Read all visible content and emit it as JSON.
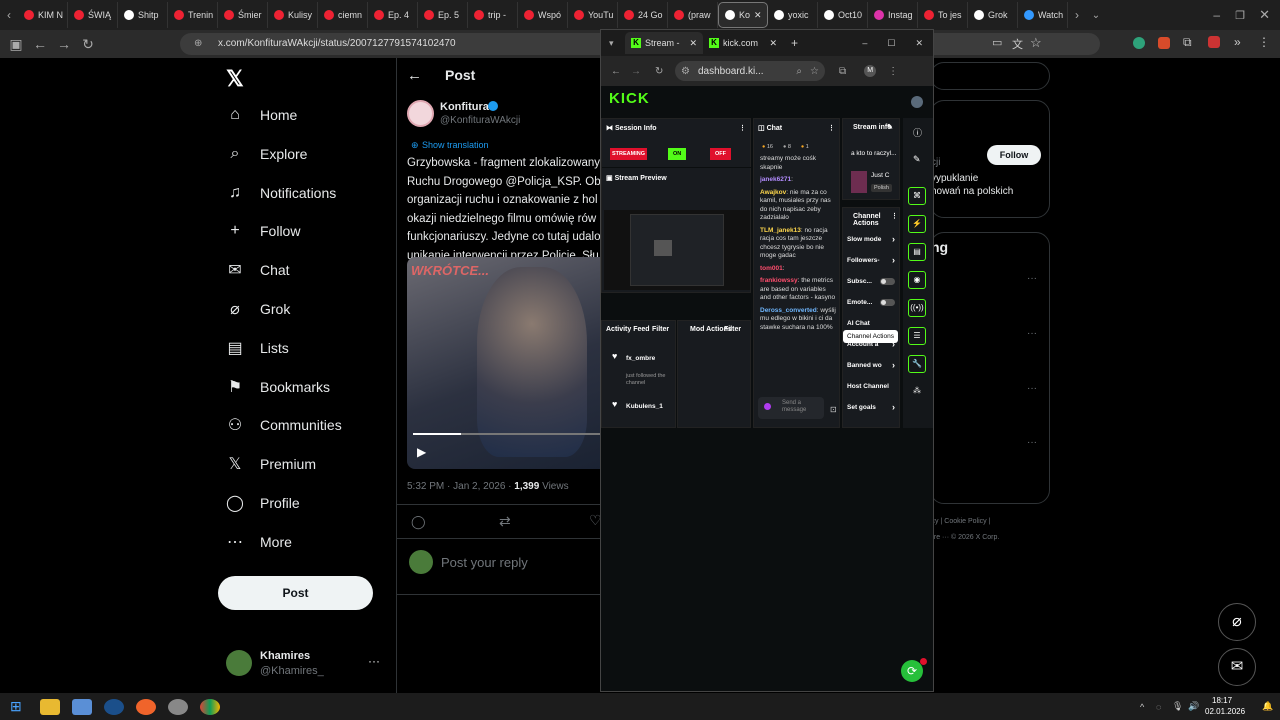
{
  "tabs": [
    {
      "label": "KIM N",
      "color": "#e23"
    },
    {
      "label": "ŚWIĄ",
      "color": "#e23"
    },
    {
      "label": "Shitp",
      "color": "#fff"
    },
    {
      "label": "Trenin",
      "color": "#e23"
    },
    {
      "label": "Śmier",
      "color": "#e23"
    },
    {
      "label": "Kulisy",
      "color": "#e23"
    },
    {
      "label": "ciemn",
      "color": "#e23"
    },
    {
      "label": "Ep. 4",
      "color": "#e23"
    },
    {
      "label": "Ep. 5",
      "color": "#e23"
    },
    {
      "label": "trip -",
      "color": "#e23"
    },
    {
      "label": "Wspó",
      "color": "#e23"
    },
    {
      "label": "YouTu",
      "color": "#e23"
    },
    {
      "label": "24 Go",
      "color": "#e23"
    },
    {
      "label": "(praw",
      "color": "#e23"
    },
    {
      "label": "Ko",
      "color": "#fff",
      "active": true
    },
    {
      "label": "yoxic",
      "color": "#fff"
    },
    {
      "label": "Oct10",
      "color": "#fff"
    },
    {
      "label": "Instag",
      "color": "#d3a"
    },
    {
      "label": "To jes",
      "color": "#e23"
    },
    {
      "label": "Grok",
      "color": "#fff"
    },
    {
      "label": "Watch",
      "color": "#39f"
    }
  ],
  "address": "x.com/KonfituraWAkcji/status/2007127791574102470",
  "nav": {
    "items": [
      "Home",
      "Explore",
      "Notifications",
      "Follow",
      "Chat",
      "Grok",
      "Lists",
      "Bookmarks",
      "Communities",
      "Premium",
      "Profile",
      "More"
    ],
    "post_label": "Post",
    "user_name": "Khamires",
    "user_handle": "@Khamires_"
  },
  "post": {
    "header": "Post",
    "author": "Konfitura",
    "handle": "@KonfituraWAkcji",
    "show_translation": "Show translation",
    "text_lines": [
      "Grzybowska - fragment zlokalizowany",
      "Ruchu Drogowego @Policja_KSP. Obi",
      "organizacji ruchu i oznakowanie z hol",
      "okazji niedzielnego filmu omówię rów",
      "funkcjonariuszy. Jedyne co tutaj udalo",
      "unikanie interwencji przez Policję. Słu"
    ],
    "video_overlay": "WKRÓTCE...",
    "timestamp": "5:32 PM · Jan 2, 2026 · ",
    "views_count": "1,399",
    "views_label": " Views",
    "reply_placeholder": "Post your reply"
  },
  "right": {
    "follow_label": "Follow",
    "snippet1": "cji",
    "snippet2": "vypuklanie",
    "snippet3": "howań na polskich",
    "heading": "ng",
    "footer1": "icy | Cookie Policy |",
    "footer2": "ore ··· © 2026 X Corp."
  },
  "popup": {
    "tab1": "Stream -",
    "tab2": "kick.com",
    "url": "dashboard.ki...",
    "logo": "KICK",
    "session_info": "Session Info",
    "streaming": "STREAMING",
    "on": "ON",
    "off": "OFF",
    "stream_preview": "Stream Preview",
    "chat_title": "Chat",
    "chat_counts": [
      "16",
      "8",
      "1"
    ],
    "chat_messages": [
      {
        "user": "",
        "text": "streamy może cośk skapnie",
        "color": "#ddd"
      },
      {
        "user": "janek6271",
        "text": ":",
        "color": "#b38cff"
      },
      {
        "user": "Awajkov",
        "text": ": nie ma za co kamil, musiales przy nas do nich napisac zeby zadzialalo",
        "color": "#ffd84d"
      },
      {
        "user": "TLM_janek13",
        "text": ": no racja racja cos tam jeszcze chcesz tygrysie bo nie moge gadac",
        "color": "#ffd84d"
      },
      {
        "user": "tom001",
        "text": ":",
        "color": "#ff4d6d"
      },
      {
        "user": "frankiowssy",
        "text": ": the metrics are based on variables and other factors - kasyno",
        "color": "#ff4d6d"
      },
      {
        "user": "Deross_converted",
        "text": ": wyślij mu edlego w bikini i ci da stawke suchara na 100%",
        "color": "#6fb7ff"
      }
    ],
    "send_placeholder": "Send a message",
    "stream_info": "Stream info",
    "stream_title": "a kto to raczyl...",
    "category": "Just C",
    "language": "Polish",
    "channel_actions": "Channel Actions",
    "actions": [
      "Slow mode",
      "Followers-",
      "Subsc...",
      "Emote...",
      "AI Chat",
      "Account a",
      "Banned wo",
      "Host Channel",
      "Set goals"
    ],
    "tooltip": "Channel Actions",
    "activity_feed": "Activity Feed",
    "filter": "Filter",
    "mod_actions": "Mod Actions",
    "feed": [
      {
        "user": "fx_ombre",
        "detail": "just followed the channel"
      },
      {
        "user": "Kubulens_1",
        "detail": ""
      }
    ]
  },
  "taskbar": {
    "time": "18:17",
    "date": "02.01.2026"
  }
}
